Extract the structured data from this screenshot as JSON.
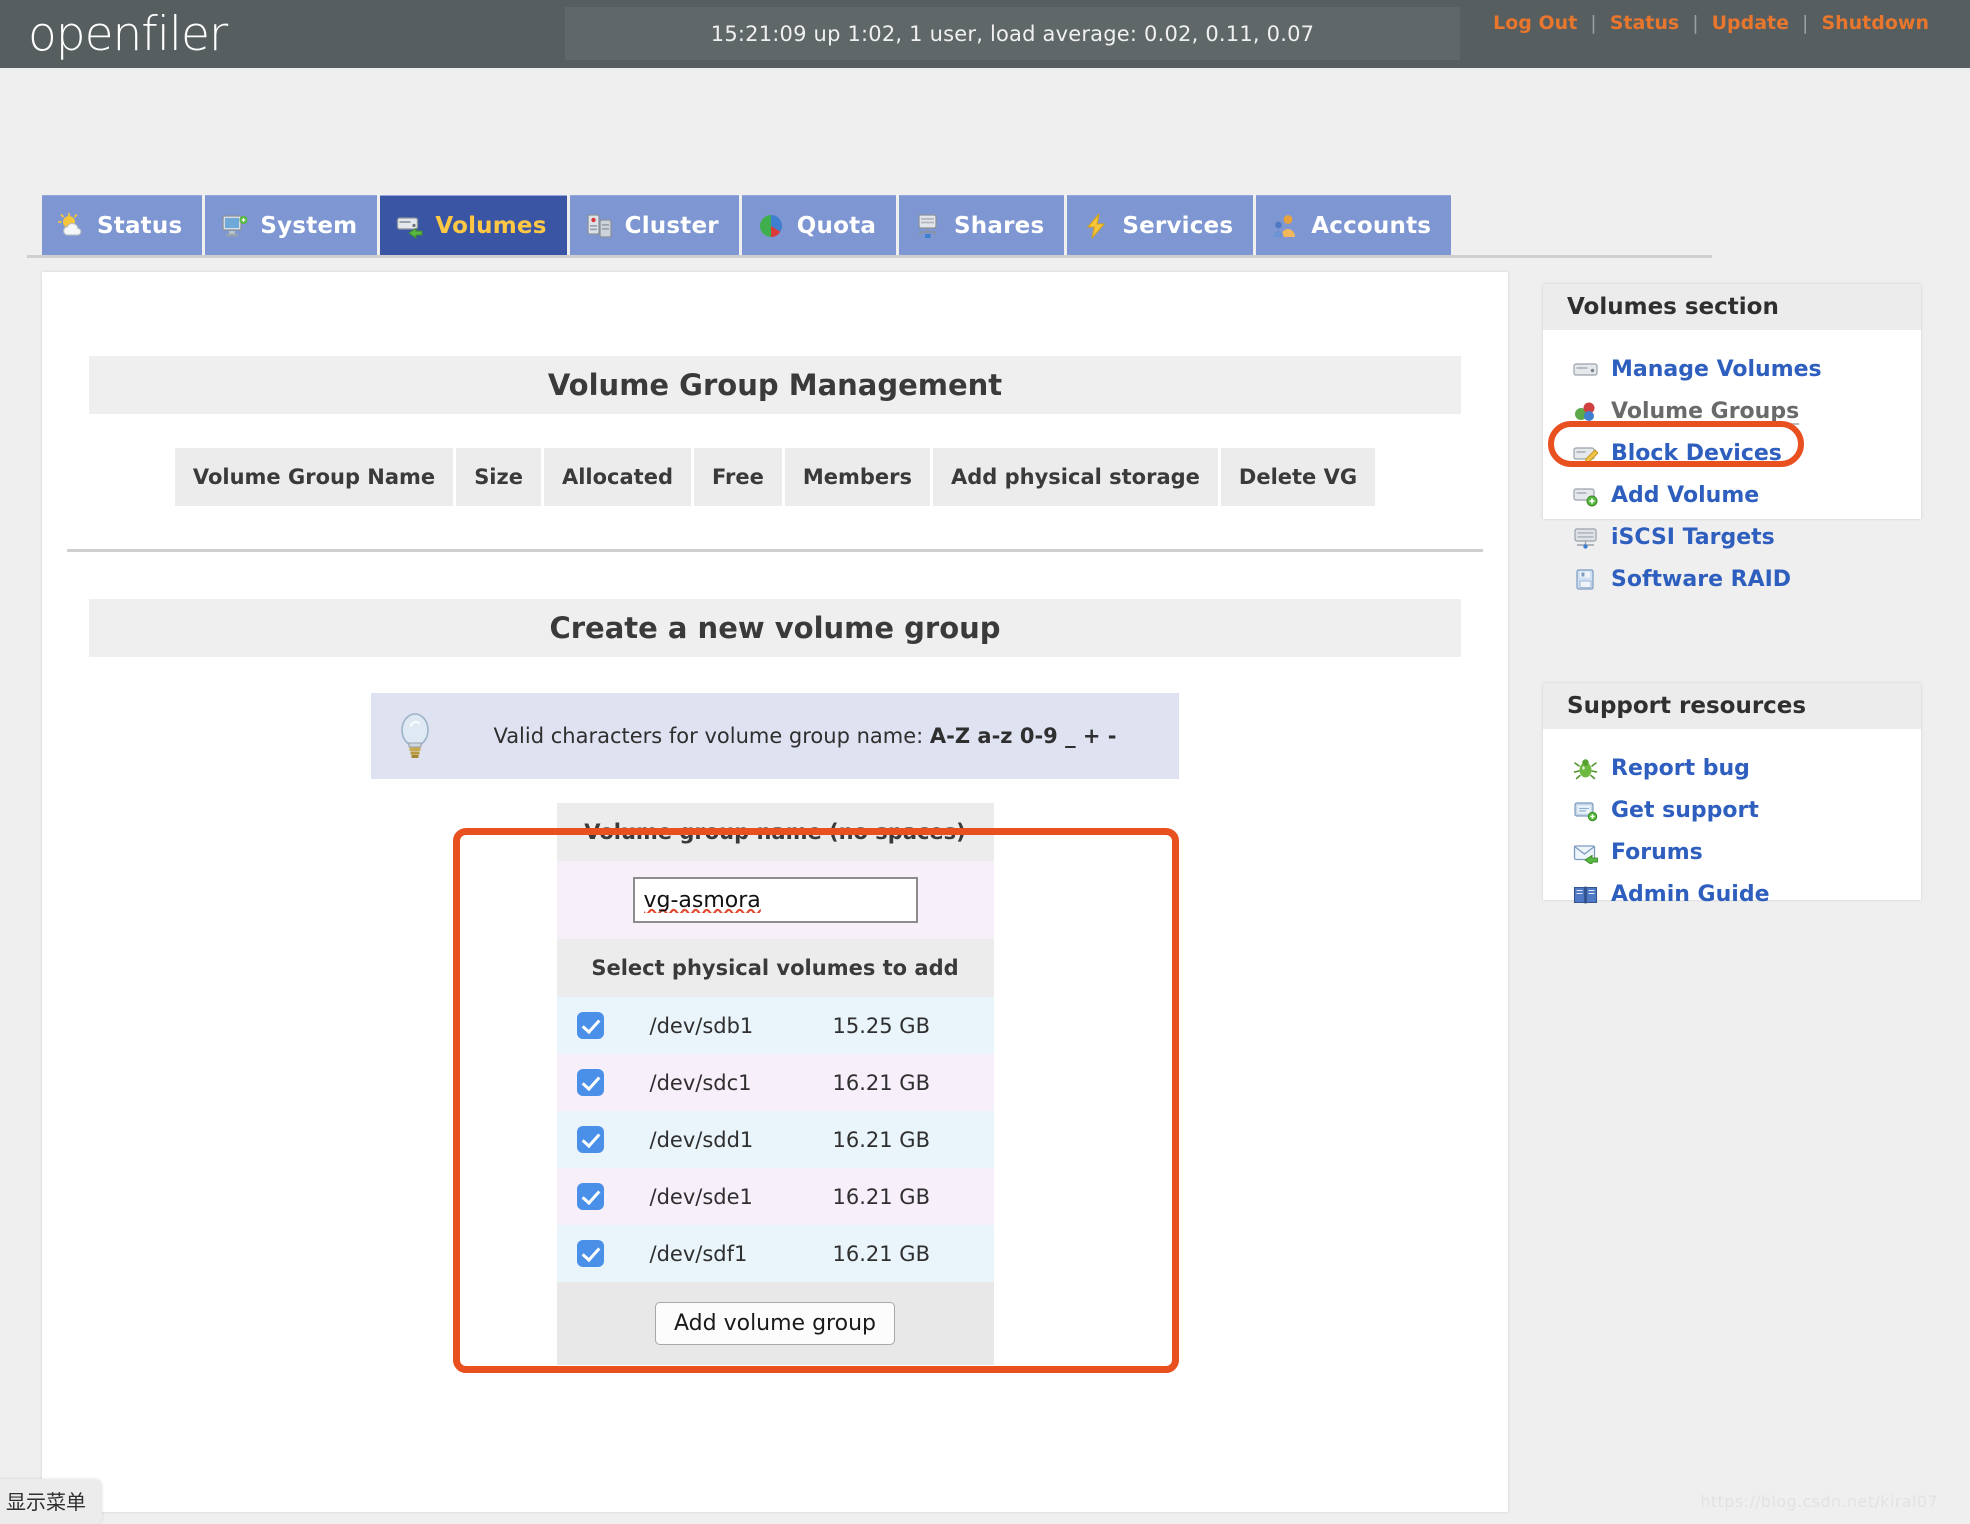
{
  "header": {
    "logo": "openfiler",
    "uptime": "15:21:09 up 1:02, 1 user, load average: 0.02, 0.11, 0.07",
    "links": [
      {
        "label": "Log Out",
        "name": "log-out-link"
      },
      {
        "label": "Status",
        "name": "status-link"
      },
      {
        "label": "Update",
        "name": "update-link"
      },
      {
        "label": "Shutdown",
        "name": "shutdown-link"
      }
    ],
    "separator": "|",
    "colors": {
      "bar_bg": "#565e60",
      "link": "#e8762c"
    }
  },
  "tabs": [
    {
      "label": "Status",
      "icon": "sun-cloud-icon",
      "active": false
    },
    {
      "label": "System",
      "icon": "monitor-icon",
      "active": false
    },
    {
      "label": "Volumes",
      "icon": "volume-disk-icon",
      "active": true
    },
    {
      "label": "Cluster",
      "icon": "servers-icon",
      "active": false
    },
    {
      "label": "Quota",
      "icon": "pie-chart-icon",
      "active": false
    },
    {
      "label": "Shares",
      "icon": "share-drive-icon",
      "active": false
    },
    {
      "label": "Services",
      "icon": "lightning-icon",
      "active": false
    },
    {
      "label": "Accounts",
      "icon": "users-icon",
      "active": false
    }
  ],
  "tab_colors": {
    "inactive_bg": "#7e96d1",
    "active_bg": "#3a55a3",
    "active_text": "#ffc844"
  },
  "main": {
    "vg_management_title": "Volume Group Management",
    "vg_table_headers": [
      "Volume Group Name",
      "Size",
      "Allocated",
      "Free",
      "Members",
      "Add physical storage",
      "Delete VG"
    ],
    "vg_table_rows": [],
    "create_title": "Create a new volume group",
    "tip": {
      "icon": "lightbulb-icon",
      "prefix": "Valid characters for volume group name: ",
      "chars": "A-Z a-z 0-9 _ + -"
    },
    "form": {
      "name_header": "Volume group name (no spaces)",
      "name_value": "vg-asmora",
      "pv_header": "Select physical volumes to add",
      "physical_volumes": [
        {
          "device": "/dev/sdb1",
          "size": "15.25 GB",
          "checked": true
        },
        {
          "device": "/dev/sdc1",
          "size": "16.21 GB",
          "checked": true
        },
        {
          "device": "/dev/sdd1",
          "size": "16.21 GB",
          "checked": true
        },
        {
          "device": "/dev/sde1",
          "size": "16.21 GB",
          "checked": true
        },
        {
          "device": "/dev/sdf1",
          "size": "16.21 GB",
          "checked": true
        }
      ],
      "submit_label": "Add volume group"
    }
  },
  "sidebar": {
    "volumes_section": {
      "title": "Volumes section",
      "items": [
        {
          "label": "Manage Volumes",
          "icon": "drive-icon",
          "current": false,
          "highlighted": false
        },
        {
          "label": "Volume Groups",
          "icon": "volume-group-icon",
          "current": true,
          "highlighted": false
        },
        {
          "label": "Block Devices",
          "icon": "block-device-icon",
          "current": false,
          "highlighted": false
        },
        {
          "label": "Add Volume",
          "icon": "add-volume-icon",
          "current": false,
          "highlighted": true
        },
        {
          "label": "iSCSI Targets",
          "icon": "iscsi-icon",
          "current": false,
          "highlighted": false
        },
        {
          "label": "Software RAID",
          "icon": "raid-icon",
          "current": false,
          "highlighted": false
        }
      ]
    },
    "support_section": {
      "title": "Support resources",
      "items": [
        {
          "label": "Report bug",
          "icon": "bug-icon"
        },
        {
          "label": "Get support",
          "icon": "support-icon"
        },
        {
          "label": "Forums",
          "icon": "mail-icon"
        },
        {
          "label": "Admin Guide",
          "icon": "book-icon"
        }
      ]
    }
  },
  "footer": {
    "show_menu": "显示菜单",
    "watermark": "https://blog.csdn.net/kiral07"
  },
  "highlight_color": "#e8501f"
}
